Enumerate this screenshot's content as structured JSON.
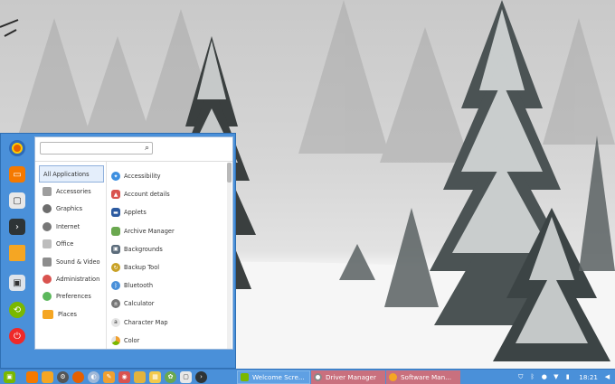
{
  "menu": {
    "search": {
      "value": "",
      "placeholder": ""
    },
    "favorites": [
      {
        "icon": "firefox-icon",
        "color": "#e66000"
      },
      {
        "icon": "files-icon",
        "color": "#f57900"
      },
      {
        "icon": "terminal-window-icon",
        "color": "#e8e8e8"
      },
      {
        "icon": "terminal-prompt-icon",
        "color": "#2e3436"
      },
      {
        "icon": "folder-icon",
        "color": "#f5a623"
      },
      {
        "icon": "display-settings-icon",
        "color": "#dfe4ea"
      },
      {
        "icon": "logout-icon",
        "color": "#7ab800"
      },
      {
        "icon": "power-icon",
        "color": "#ef2929"
      }
    ],
    "categories": [
      {
        "label": "All Applications",
        "icon": "all-apps-icon",
        "color": "#ffffff"
      },
      {
        "label": "Accessories",
        "icon": "accessories-icon",
        "color": "#9e9e9e"
      },
      {
        "label": "Graphics",
        "icon": "graphics-icon",
        "color": "#6d6d6d"
      },
      {
        "label": "Internet",
        "icon": "internet-icon",
        "color": "#777777"
      },
      {
        "label": "Office",
        "icon": "office-icon",
        "color": "#bdbdbd"
      },
      {
        "label": "Sound & Video",
        "icon": "sound-video-icon",
        "color": "#8d8d8d"
      },
      {
        "label": "Administration",
        "icon": "administration-icon",
        "color": "#d9534f"
      },
      {
        "label": "Preferences",
        "icon": "preferences-icon",
        "color": "#5cb85c"
      },
      {
        "label": "Places",
        "icon": "places-folder-icon",
        "color": "#f5a623"
      }
    ],
    "apps": [
      {
        "label": "Accessibility",
        "icon": "accessibility-icon",
        "color": "#3d8fe0"
      },
      {
        "label": "Account details",
        "icon": "account-details-icon",
        "color": "#d9534f"
      },
      {
        "label": "Applets",
        "icon": "applets-icon",
        "color": "#2c5aa0"
      },
      {
        "label": "Archive Manager",
        "icon": "archive-manager-icon",
        "color": "#6aa84f"
      },
      {
        "label": "Backgrounds",
        "icon": "backgrounds-icon",
        "color": "#5b6b7a"
      },
      {
        "label": "Backup Tool",
        "icon": "backup-tool-icon",
        "color": "#c9a227"
      },
      {
        "label": "Bluetooth",
        "icon": "bluetooth-icon",
        "color": "#4a90d9"
      },
      {
        "label": "Calculator",
        "icon": "calculator-icon",
        "color": "#777777"
      },
      {
        "label": "Character Map",
        "icon": "character-map-icon",
        "color": "#e5e5e5"
      },
      {
        "label": "Color",
        "icon": "color-icon",
        "color": "#f0a030"
      }
    ]
  },
  "taskbar": {
    "launchers": [
      "mint-menu-icon",
      "files-icon",
      "folder-icon",
      "settings-gear-icon",
      "firefox-icon",
      "weather-icon",
      "paint-icon",
      "camera-icon",
      "folder-icon",
      "archive-icon",
      "software-center-icon",
      "terminal-window-icon",
      "terminal-prompt-icon"
    ],
    "windows": [
      {
        "label": "Welcome Scre...",
        "icon": "welcome-icon"
      },
      {
        "label": "Driver Manager",
        "icon": "driver-manager-icon"
      },
      {
        "label": "Software Man...",
        "icon": "software-manager-icon"
      }
    ],
    "tray": [
      "shield-icon",
      "bluetooth-icon",
      "user-icon",
      "network-icon",
      "battery-icon",
      "volume-icon"
    ],
    "clock": "18:21"
  }
}
